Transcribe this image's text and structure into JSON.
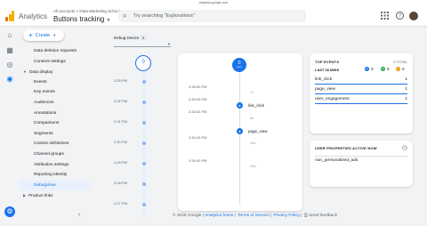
{
  "browser": {
    "url": "analytics.google.com"
  },
  "header": {
    "app_name": "Analytics",
    "account_crumb": "All accounts > Data Marketing School",
    "property_name": "Buttons tracking",
    "search_placeholder": "Try searching \"Explorations\"",
    "icons": [
      "apps-grid-icon",
      "help-icon",
      "avatar"
    ]
  },
  "colors": {
    "accent": "#1a73e8",
    "active_bg": "#e8f0fe",
    "logo_orange": "#f9ab00",
    "logo_dark": "#e37400"
  },
  "rail": {
    "items": [
      "home-icon",
      "reports-icon",
      "explore-icon",
      "advertising-icon"
    ]
  },
  "nav": {
    "create_label": "Create",
    "items": [
      {
        "label": "Data deletion requests",
        "type": "child"
      },
      {
        "label": "Consent settings",
        "type": "child"
      },
      {
        "label": "Data display",
        "type": "section",
        "expanded": true
      },
      {
        "label": "Events",
        "type": "child"
      },
      {
        "label": "Key events",
        "type": "child"
      },
      {
        "label": "Audiences",
        "type": "child"
      },
      {
        "label": "Annotations",
        "type": "child"
      },
      {
        "label": "Comparisons",
        "type": "child"
      },
      {
        "label": "Segments",
        "type": "child"
      },
      {
        "label": "Custom definitions",
        "type": "child"
      },
      {
        "label": "Channel groups",
        "type": "child"
      },
      {
        "label": "Attribution settings",
        "type": "child"
      },
      {
        "label": "Reporting identity",
        "type": "child"
      },
      {
        "label": "DebugView",
        "type": "child",
        "active": true
      },
      {
        "label": "Product links",
        "type": "section",
        "expanded": false
      }
    ]
  },
  "debug": {
    "device_label": "Debug Device",
    "device_count": "0"
  },
  "minutes": {
    "bubble": "0",
    "times": [
      "2:33 PM",
      "2:32 PM",
      "2:31 PM",
      "2:30 PM",
      "2:29 PM",
      "2:28 PM",
      "2:27 PM"
    ]
  },
  "seconds": {
    "bubble_count": "0",
    "bubble_unit": "secs",
    "times": [
      "2:35:00 PM",
      "2:34:53 PM",
      "2:34:52 PM",
      "2:34:43 PM",
      "2:34:00 PM"
    ],
    "gaps": [
      "7s",
      "8s",
      "43s",
      "42s"
    ],
    "events": [
      "link_click",
      "page_view"
    ]
  },
  "top_events": {
    "title": "TOP EVENTS",
    "total": "3 TOTAL",
    "last_label": "LAST 30 MINS",
    "counters": [
      {
        "value": "3",
        "color": "#1a73e8"
      },
      {
        "value": "0",
        "color": "#34a853"
      },
      {
        "value": "0",
        "color": "#f29900"
      }
    ],
    "rows": [
      {
        "name": "link_click",
        "count": "1"
      },
      {
        "name": "page_view",
        "count": "1"
      },
      {
        "name": "user_engagement",
        "count": "1"
      }
    ]
  },
  "user_properties": {
    "title": "USER PROPERTIES ACTIVE NOW",
    "rows": [
      "non_personalized_ads"
    ]
  },
  "footer": {
    "copyright": "© 2025 Google |",
    "links": [
      "Analytics home",
      "Terms of Service",
      "Privacy Policy"
    ],
    "feedback": "Send feedback"
  }
}
